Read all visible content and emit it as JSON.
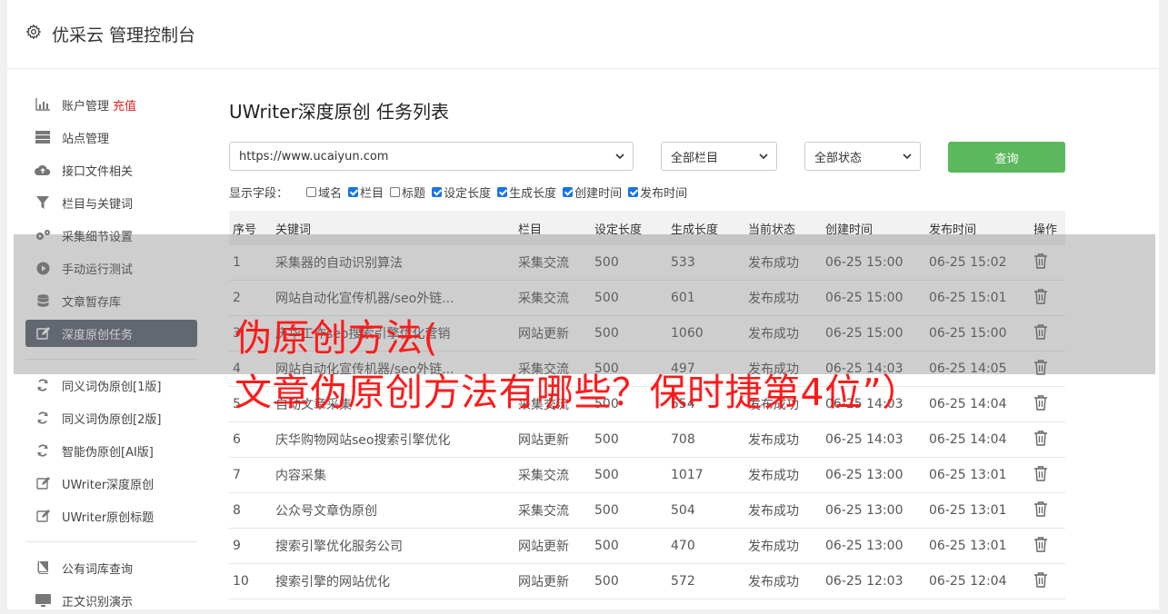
{
  "header": {
    "title": "优采云 管理控制台",
    "icon": "gear-icon"
  },
  "sidebar": {
    "items": [
      {
        "label": "账户管理",
        "badge": "充值",
        "icon": "bar-chart-icon"
      },
      {
        "label": "站点管理",
        "icon": "server-icon"
      },
      {
        "label": "接口文件相关",
        "icon": "cloud-upload-icon"
      },
      {
        "label": "栏目与关键词",
        "icon": "filter-icon"
      },
      {
        "label": "采集细节设置",
        "icon": "cogs-icon"
      },
      {
        "label": "手动运行测试",
        "icon": "play-circle-icon"
      },
      {
        "label": "文章暂存库",
        "icon": "database-icon"
      },
      {
        "label": "深度原创任务",
        "icon": "edit-icon",
        "active": true
      },
      {
        "label": "同义词伪原创[1版]",
        "icon": "refresh-icon"
      },
      {
        "label": "同义词伪原创[2版]",
        "icon": "refresh-icon"
      },
      {
        "label": "智能伪原创[AI版]",
        "icon": "refresh-icon"
      },
      {
        "label": "UWriter深度原创",
        "icon": "edit-icon"
      },
      {
        "label": "UWriter原创标题",
        "icon": "edit-icon"
      },
      {
        "label": "公有词库查询",
        "icon": "book-icon"
      },
      {
        "label": "正文识别演示",
        "icon": "monitor-icon"
      }
    ]
  },
  "main": {
    "title": "UWriter深度原创 任务列表",
    "site_select": "https://www.ucaiyun.com",
    "column_select": "全部栏目",
    "status_select": "全部状态",
    "query_button": "查询",
    "fields_label": "显示字段：",
    "fields": [
      {
        "label": "域名",
        "checked": false
      },
      {
        "label": "栏目",
        "checked": true
      },
      {
        "label": "标题",
        "checked": false
      },
      {
        "label": "设定长度",
        "checked": true
      },
      {
        "label": "生成长度",
        "checked": true
      },
      {
        "label": "创建时间",
        "checked": true
      },
      {
        "label": "发布时间",
        "checked": true
      }
    ],
    "table": {
      "headers": [
        "序号",
        "关键词",
        "栏目",
        "设定长度",
        "生成长度",
        "当前状态",
        "创建时间",
        "发布时间",
        "操作"
      ],
      "rows": [
        [
          "1",
          "采集器的自动识别算法",
          "采集交流",
          "500",
          "533",
          "发布成功",
          "06-25 15:00",
          "06-25 15:02"
        ],
        [
          "2",
          "网站自动化宣传机器/seo外链...",
          "采集交流",
          "500",
          "601",
          "发布成功",
          "06-25 15:00",
          "06-25 15:01"
        ],
        [
          "3",
          "庆华工作seo搜索引擎优化营销",
          "网站更新",
          "500",
          "1060",
          "发布成功",
          "06-25 15:00",
          "06-25 15:00"
        ],
        [
          "4",
          "网站自动化宣传机器/seo外链...",
          "采集交流",
          "500",
          "497",
          "发布成功",
          "06-25 14:03",
          "06-25 14:05"
        ],
        [
          "5",
          "自动文章采集",
          "采集交流",
          "500",
          "554",
          "发布成功",
          "06-25 14:03",
          "06-25 14:04"
        ],
        [
          "6",
          "庆华购物网站seo搜索引擎优化",
          "网站更新",
          "500",
          "708",
          "发布成功",
          "06-25 14:03",
          "06-25 14:04"
        ],
        [
          "7",
          "内容采集",
          "采集交流",
          "500",
          "1017",
          "发布成功",
          "06-25 13:00",
          "06-25 13:01"
        ],
        [
          "8",
          "公众号文章伪原创",
          "采集交流",
          "500",
          "504",
          "发布成功",
          "06-25 13:00",
          "06-25 13:01"
        ],
        [
          "9",
          "搜索引擎优化服务公司",
          "网站更新",
          "500",
          "470",
          "发布成功",
          "06-25 13:00",
          "06-25 13:01"
        ],
        [
          "10",
          "搜索引擎的网站优化",
          "网站更新",
          "500",
          "572",
          "发布成功",
          "06-25 12:03",
          "06-25 12:04"
        ]
      ]
    }
  },
  "overlay": {
    "line1": "伪原创方法(",
    "line2": "文章伪原创方法有哪些？保时捷第4位”）"
  },
  "colors": {
    "accent_green": "#5cb85c",
    "status_ok": "#2e8b2e",
    "overlay_text": "#ff1a1a",
    "active_nav": "#5a6270",
    "badge": "#e02020"
  }
}
